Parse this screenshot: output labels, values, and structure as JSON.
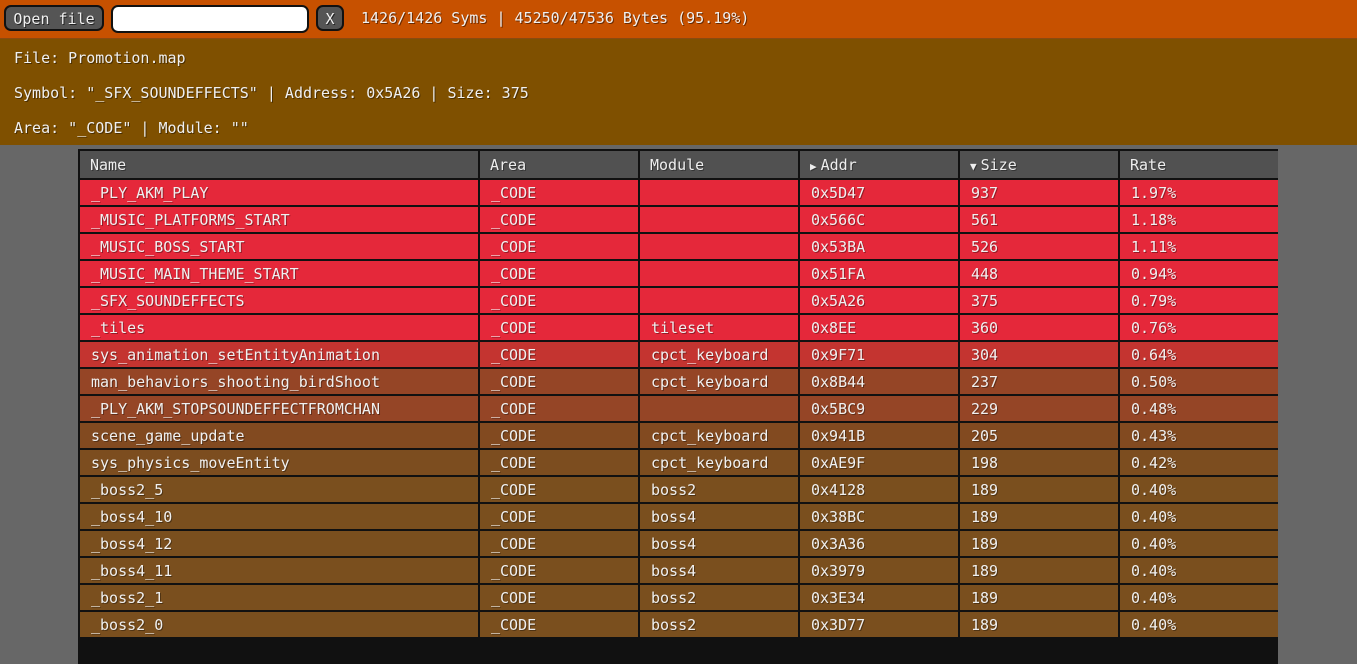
{
  "toolbar": {
    "open_label": "Open file",
    "search_value": "",
    "search_placeholder": "",
    "clear_label": "X",
    "stats": "1426/1426 Syms | 45250/47536 Bytes (95.19%)"
  },
  "info": {
    "file": "File: Promotion.map",
    "symbol": "Symbol: \"_SFX_SOUNDEFFECTS\" | Address: 0x5A26 | Size: 375",
    "area": "Area: \"_CODE\" | Module: \"\""
  },
  "colors": {
    "topbar": "#c75100",
    "infopanel": "#7f5000",
    "header": "#515151",
    "background": "#676767"
  },
  "table": {
    "columns": [
      {
        "label": "Name",
        "icon": ""
      },
      {
        "label": "Area",
        "icon": ""
      },
      {
        "label": "Module",
        "icon": ""
      },
      {
        "label": "Addr",
        "icon": "triangle-right-icon",
        "glyph": "▶"
      },
      {
        "label": "Size",
        "icon": "triangle-down-icon",
        "glyph": "▼"
      },
      {
        "label": "Rate",
        "icon": ""
      }
    ],
    "rows": [
      {
        "name": "_PLY_AKM_PLAY",
        "area": "_CODE",
        "module": "",
        "addr": "0x5D47",
        "size": "937",
        "rate": "1.97%",
        "color": "#e5283a"
      },
      {
        "name": "_MUSIC_PLATFORMS_START",
        "area": "_CODE",
        "module": "",
        "addr": "0x566C",
        "size": "561",
        "rate": "1.18%",
        "color": "#e5283a"
      },
      {
        "name": "_MUSIC_BOSS_START",
        "area": "_CODE",
        "module": "",
        "addr": "0x53BA",
        "size": "526",
        "rate": "1.11%",
        "color": "#e5283a"
      },
      {
        "name": "_MUSIC_MAIN_THEME_START",
        "area": "_CODE",
        "module": "",
        "addr": "0x51FA",
        "size": "448",
        "rate": "0.94%",
        "color": "#e5283a"
      },
      {
        "name": "_SFX_SOUNDEFFECTS",
        "area": "_CODE",
        "module": "",
        "addr": "0x5A26",
        "size": "375",
        "rate": "0.79%",
        "color": "#e5283a"
      },
      {
        "name": "_tiles",
        "area": "_CODE",
        "module": "tileset",
        "addr": "0x8EE",
        "size": "360",
        "rate": "0.76%",
        "color": "#e5283a"
      },
      {
        "name": "sys_animation_setEntityAnimation",
        "area": "_CODE",
        "module": "cpct_keyboard",
        "addr": "0x9F71",
        "size": "304",
        "rate": "0.64%",
        "color": "#c43430"
      },
      {
        "name": "man_behaviors_shooting_birdShoot",
        "area": "_CODE",
        "module": "cpct_keyboard",
        "addr": "0x8B44",
        "size": "237",
        "rate": "0.50%",
        "color": "#954526"
      },
      {
        "name": "_PLY_AKM_STOPSOUNDEFFECTFROMCHAN",
        "area": "_CODE",
        "module": "",
        "addr": "0x5BC9",
        "size": "229",
        "rate": "0.48%",
        "color": "#954526"
      },
      {
        "name": "scene_game_update",
        "area": "_CODE",
        "module": "cpct_keyboard",
        "addr": "0x941B",
        "size": "205",
        "rate": "0.43%",
        "color": "#824a20"
      },
      {
        "name": "sys_physics_moveEntity",
        "area": "_CODE",
        "module": "cpct_keyboard",
        "addr": "0xAE9F",
        "size": "198",
        "rate": "0.42%",
        "color": "#7c4d1f"
      },
      {
        "name": "_boss2_5",
        "area": "_CODE",
        "module": "boss2",
        "addr": "0x4128",
        "size": "189",
        "rate": "0.40%",
        "color": "#7a4f1e"
      },
      {
        "name": "_boss4_10",
        "area": "_CODE",
        "module": "boss4",
        "addr": "0x38BC",
        "size": "189",
        "rate": "0.40%",
        "color": "#7a4f1e"
      },
      {
        "name": "_boss4_12",
        "area": "_CODE",
        "module": "boss4",
        "addr": "0x3A36",
        "size": "189",
        "rate": "0.40%",
        "color": "#7a4f1e"
      },
      {
        "name": "_boss4_11",
        "area": "_CODE",
        "module": "boss4",
        "addr": "0x3979",
        "size": "189",
        "rate": "0.40%",
        "color": "#7a4f1e"
      },
      {
        "name": "_boss2_1",
        "area": "_CODE",
        "module": "boss2",
        "addr": "0x3E34",
        "size": "189",
        "rate": "0.40%",
        "color": "#7a4f1e"
      },
      {
        "name": "_boss2_0",
        "area": "_CODE",
        "module": "boss2",
        "addr": "0x3D77",
        "size": "189",
        "rate": "0.40%",
        "color": "#7a4f1e"
      }
    ]
  }
}
